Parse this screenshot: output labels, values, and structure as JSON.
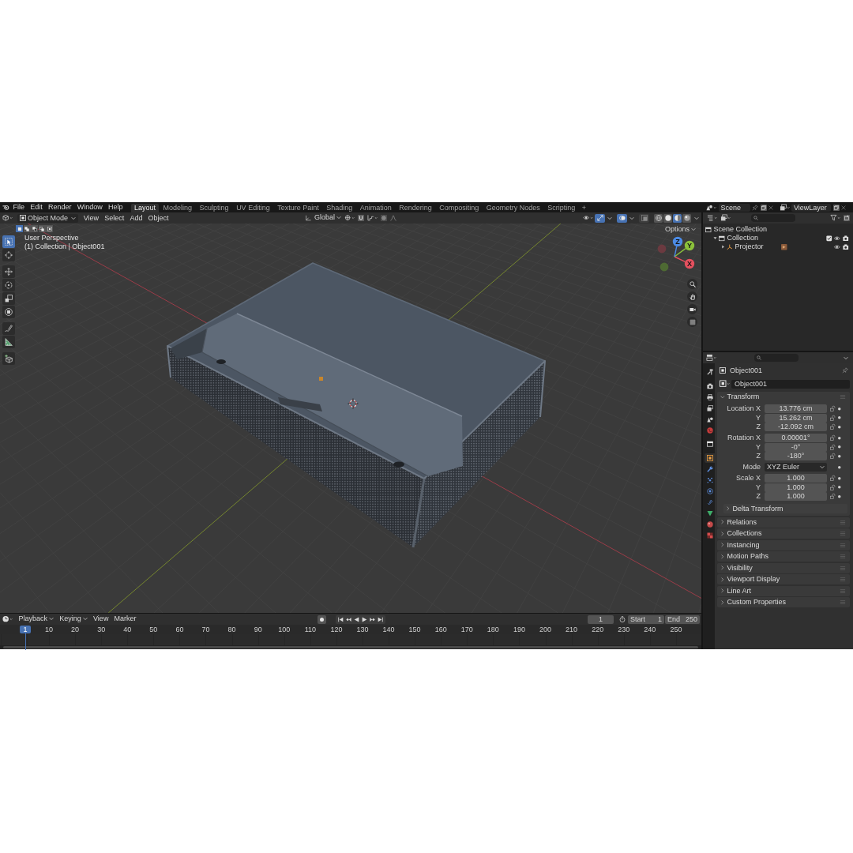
{
  "top_bar": {
    "menus": [
      "File",
      "Edit",
      "Render",
      "Window",
      "Help"
    ],
    "workspaces": [
      {
        "label": "Layout",
        "selected": true
      },
      {
        "label": "Modeling",
        "selected": false
      },
      {
        "label": "Sculpting",
        "selected": false
      },
      {
        "label": "UV Editing",
        "selected": false
      },
      {
        "label": "Texture Paint",
        "selected": false
      },
      {
        "label": "Shading",
        "selected": false
      },
      {
        "label": "Animation",
        "selected": false
      },
      {
        "label": "Rendering",
        "selected": false
      },
      {
        "label": "Compositing",
        "selected": false
      },
      {
        "label": "Geometry Nodes",
        "selected": false
      },
      {
        "label": "Scripting",
        "selected": false
      }
    ],
    "add_workspace": "+",
    "scene": "Scene",
    "view_layer": "ViewLayer"
  },
  "viewport": {
    "mode": "Object Mode",
    "menus": [
      "View",
      "Select",
      "Add",
      "Object"
    ],
    "orientation": "Global",
    "toggles": [
      {
        "kind": "gizmos",
        "on": true
      },
      {
        "kind": "overlays",
        "on": true
      },
      {
        "kind": "xray",
        "on": false
      }
    ],
    "shading_modes": [
      {
        "kind": "wireframe",
        "selected": false
      },
      {
        "kind": "solid",
        "selected": false
      },
      {
        "kind": "material",
        "selected": true
      },
      {
        "kind": "rendered",
        "selected": false
      }
    ],
    "select_modes": [
      {
        "kind": "set",
        "selected": true
      },
      {
        "kind": "extend",
        "selected": false
      },
      {
        "kind": "subtract",
        "selected": false
      },
      {
        "kind": "difference",
        "selected": false
      },
      {
        "kind": "intersect",
        "selected": false
      }
    ],
    "options": "Options",
    "tool_groups": [
      [
        {
          "kind": "select-box",
          "selected": true
        },
        {
          "kind": "cursor",
          "selected": false
        }
      ],
      [
        {
          "kind": "move",
          "selected": false
        },
        {
          "kind": "rotate",
          "selected": false
        },
        {
          "kind": "scale",
          "selected": false
        },
        {
          "kind": "transform",
          "selected": false
        }
      ],
      [
        {
          "kind": "annotate",
          "selected": false
        },
        {
          "kind": "measure",
          "selected": false
        }
      ],
      [
        {
          "kind": "add-cube",
          "selected": false
        }
      ]
    ],
    "view_name": "User Perspective",
    "view_context": "(1) Collection | Object001",
    "gizmo_axes": [
      {
        "label": "X",
        "color": "#e5505e"
      },
      {
        "label": "Y",
        "color": "#8bc13b"
      },
      {
        "label": "Z",
        "color": "#4c8ce6"
      }
    ]
  },
  "outliner": {
    "tree": [
      {
        "kind": "scene-collection",
        "label": "Scene Collection",
        "children": [
          {
            "kind": "collection",
            "label": "Collection",
            "expanded": true,
            "checked": true,
            "children": [
              {
                "kind": "object",
                "label": "Projector",
                "expanded": false
              }
            ]
          }
        ]
      }
    ]
  },
  "properties": {
    "tab_groups": [
      [
        {
          "kind": "tool",
          "selected": false
        }
      ],
      [
        {
          "kind": "render",
          "selected": false
        },
        {
          "kind": "output",
          "selected": false
        },
        {
          "kind": "view-layer",
          "selected": false
        },
        {
          "kind": "scene",
          "selected": false
        },
        {
          "kind": "world",
          "selected": false
        }
      ],
      [
        {
          "kind": "collection",
          "selected": false
        }
      ],
      [
        {
          "kind": "object",
          "selected": true
        },
        {
          "kind": "modifiers",
          "selected": false
        },
        {
          "kind": "particles",
          "selected": false
        },
        {
          "kind": "physics",
          "selected": false
        },
        {
          "kind": "constraints",
          "selected": false
        },
        {
          "kind": "data",
          "selected": false
        },
        {
          "kind": "material",
          "selected": false
        },
        {
          "kind": "texture",
          "selected": false
        }
      ]
    ],
    "object_name": "Object001",
    "datablock": "Object001",
    "transform": {
      "label": "Transform",
      "expanded": true,
      "groups": [
        {
          "rows": [
            {
              "kind": "number",
              "label": "Location X",
              "value": "13.776 cm"
            },
            {
              "kind": "number",
              "label": "Y",
              "value": "15.262 cm"
            },
            {
              "kind": "number",
              "label": "Z",
              "value": "-12.092 cm"
            }
          ]
        },
        {
          "rows": [
            {
              "kind": "number",
              "label": "Rotation X",
              "value": "0.00001°"
            },
            {
              "kind": "number",
              "label": "Y",
              "value": "-0°"
            },
            {
              "kind": "number",
              "label": "Z",
              "value": "-180°"
            }
          ]
        },
        {
          "rows": [
            {
              "kind": "dropdown",
              "label": "Mode",
              "value": "XYZ Euler"
            }
          ]
        },
        {
          "rows": [
            {
              "kind": "number",
              "label": "Scale X",
              "value": "1.000"
            },
            {
              "kind": "number",
              "label": "Y",
              "value": "1.000"
            },
            {
              "kind": "number",
              "label": "Z",
              "value": "1.000"
            }
          ]
        }
      ],
      "subpanels": [
        {
          "label": "Delta Transform",
          "expanded": false
        }
      ]
    },
    "panels": [
      {
        "label": "Relations",
        "expanded": false
      },
      {
        "label": "Collections",
        "expanded": false
      },
      {
        "label": "Instancing",
        "expanded": false
      },
      {
        "label": "Motion Paths",
        "expanded": false
      },
      {
        "label": "Visibility",
        "expanded": false
      },
      {
        "label": "Viewport Display",
        "expanded": false
      },
      {
        "label": "Line Art",
        "expanded": false
      },
      {
        "label": "Custom Properties",
        "expanded": false
      }
    ]
  },
  "timeline": {
    "menus": [
      {
        "label": "Playback",
        "dropdown": true
      },
      {
        "label": "Keying",
        "dropdown": true
      },
      {
        "label": "View",
        "dropdown": false
      },
      {
        "label": "Marker",
        "dropdown": false
      }
    ],
    "frame": "1",
    "start_label": "Start",
    "start": "1",
    "end_label": "End",
    "end": "250",
    "playhead": "1",
    "ruler": [
      "10",
      "20",
      "30",
      "40",
      "50",
      "60",
      "70",
      "80",
      "90",
      "100",
      "110",
      "120",
      "130",
      "140",
      "150",
      "160",
      "170",
      "180",
      "190",
      "200",
      "210",
      "220",
      "230",
      "240",
      "250"
    ]
  }
}
